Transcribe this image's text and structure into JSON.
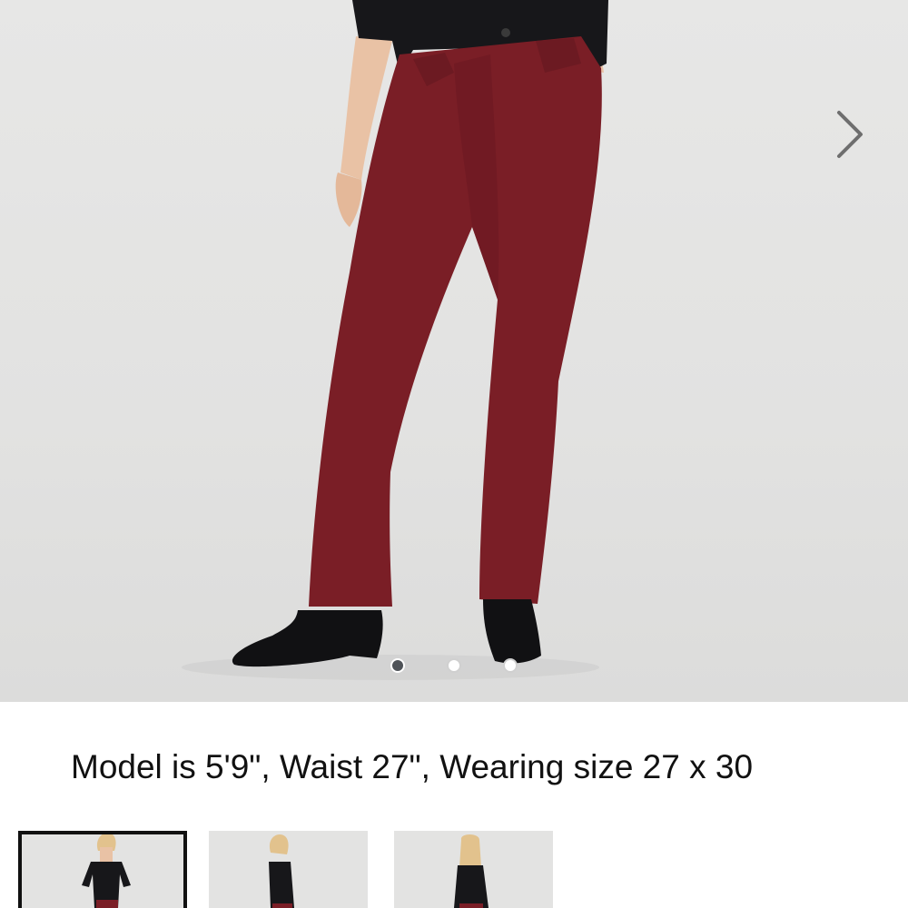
{
  "gallery": {
    "product_color": "#7a1e26",
    "next_button": {
      "icon": "chevron-right-icon"
    },
    "dots": [
      {
        "state": "active"
      },
      {
        "state": "inactive"
      },
      {
        "state": "inactive"
      }
    ]
  },
  "caption": {
    "text": "Model is 5'9\", Waist 27\", Wearing size 27 x 30"
  },
  "thumbnails": [
    {
      "view": "front",
      "selected": true
    },
    {
      "view": "side",
      "selected": false
    },
    {
      "view": "back",
      "selected": false
    }
  ]
}
